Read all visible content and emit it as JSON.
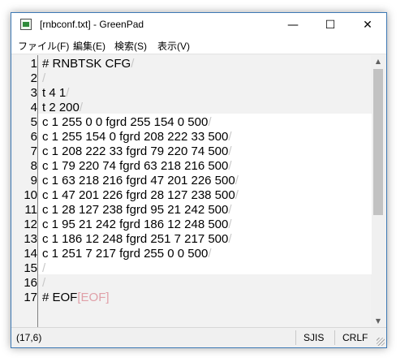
{
  "window": {
    "title": "[rnbconf.txt] - GreenPad",
    "min_icon": "—",
    "max_icon": "☐",
    "close_icon": "✕"
  },
  "menu": [
    "ファイル(F)",
    "編集(E)",
    "検索(S)",
    "表示(V)"
  ],
  "eol_glyph": "/",
  "lines": [
    {
      "num": "1",
      "text": "# RNBTSK CFG"
    },
    {
      "num": "2",
      "text": ""
    },
    {
      "num": "3",
      "text": "t 4 1"
    },
    {
      "num": "4",
      "text": "t 2 200"
    },
    {
      "num": "5",
      "text": "c 1 255 0 0 fgrd 255 154 0 500"
    },
    {
      "num": "6",
      "text": "c 1 255 154 0 fgrd 208 222 33 500"
    },
    {
      "num": "7",
      "text": "c 1 208 222 33 fgrd 79 220 74 500"
    },
    {
      "num": "8",
      "text": "c 1 79 220 74 fgrd 63 218 216 500"
    },
    {
      "num": "9",
      "text": "c 1 63 218 216 fgrd 47 201 226 500"
    },
    {
      "num": "10",
      "text": "c 1 47 201 226 fgrd 28 127 238 500"
    },
    {
      "num": "11",
      "text": "c 1 28 127 238 fgrd 95 21 242 500"
    },
    {
      "num": "12",
      "text": "c 1 95 21 242 fgrd 186 12 248 500"
    },
    {
      "num": "13",
      "text": "c 1 186 12 248 fgrd 251 7 217 500"
    },
    {
      "num": "14",
      "text": "c 1 251 7 217 fgrd 255 0 0 500"
    },
    {
      "num": "15",
      "text": ""
    },
    {
      "num": "16",
      "text": ""
    },
    {
      "num": "17",
      "text": "# EOF",
      "eof": "[EOF]"
    }
  ],
  "status": {
    "position": "(17,6)",
    "encoding": "SJIS",
    "line_ending": "CRLF"
  }
}
